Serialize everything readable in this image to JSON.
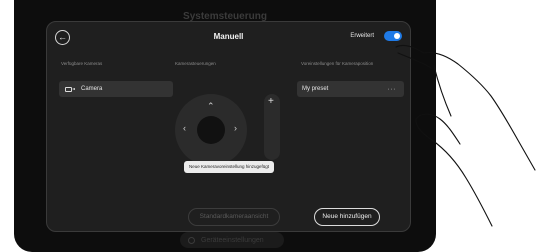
{
  "background": {
    "title": "Systemsteuerung",
    "footer_label": "Geräteeinstellungen"
  },
  "dialog": {
    "title": "Manuell",
    "back_icon": "arrow-left-icon",
    "advanced_label": "Erweitert",
    "advanced_enabled": true
  },
  "columns": {
    "cameras_header": "Verfügbare Kameras",
    "controls_header": "Kamerasteuerungen",
    "presets_header": "Voreinstellungen für Kameraposition"
  },
  "cameras": [
    {
      "label": "Camera",
      "icon": "camera-icon"
    }
  ],
  "presets": [
    {
      "label": "My preset",
      "more": "···"
    }
  ],
  "controls": {
    "zoom_in": "+",
    "up": "⌃",
    "left": "‹",
    "right": "›"
  },
  "toast": "Neue Kameravoreinstellung hinzugefügt",
  "buttons": {
    "default_view": "Standardkameraansicht",
    "add_new": "Neue hinzufügen"
  },
  "colors": {
    "accent": "#1f7ae6",
    "panel": "#1f1f1f",
    "row": "#333333"
  }
}
